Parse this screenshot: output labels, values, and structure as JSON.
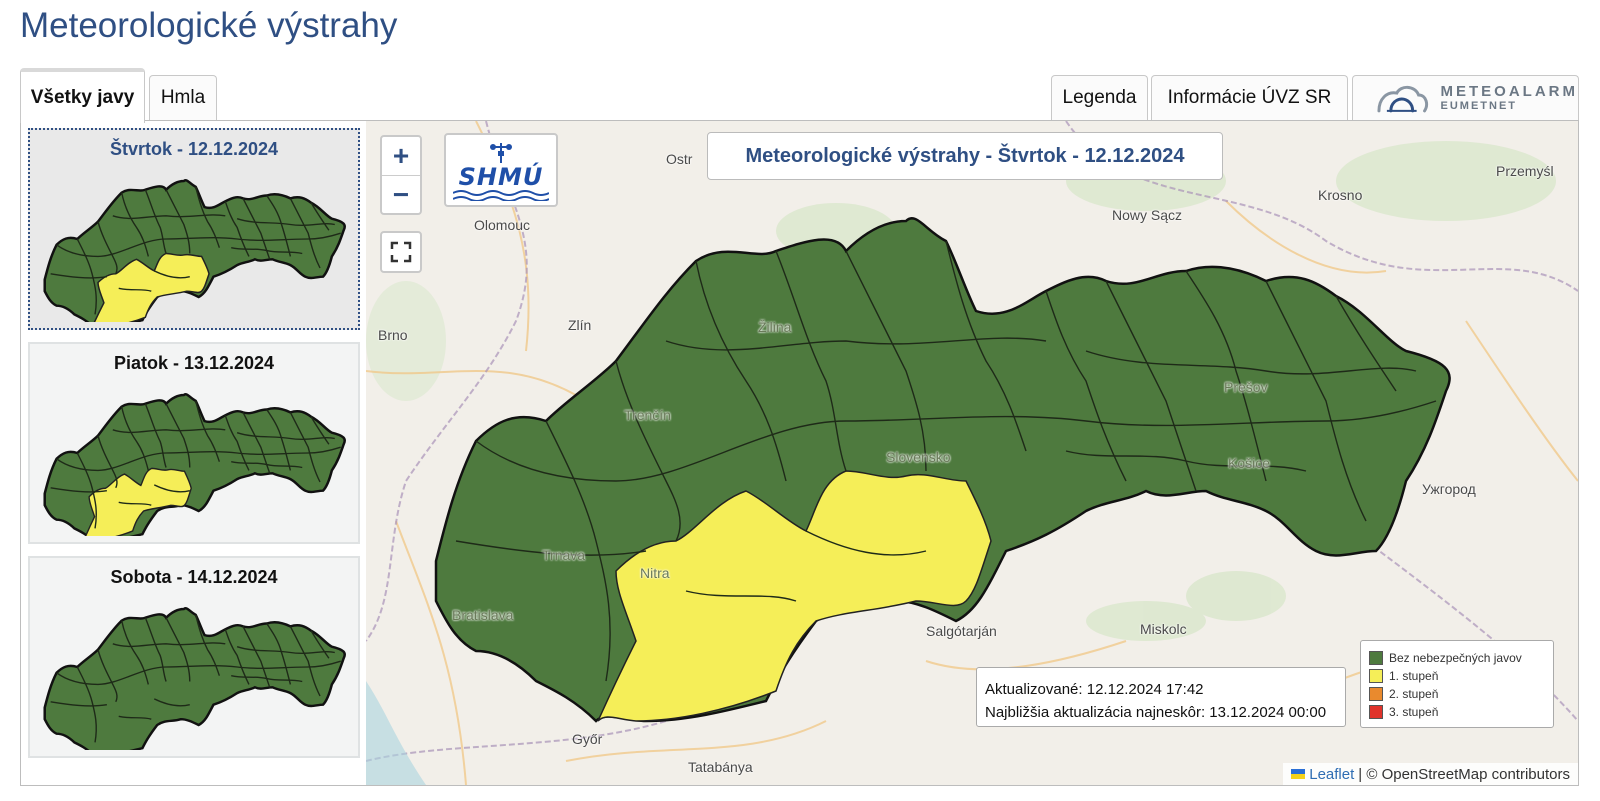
{
  "page_title": "Meteorologické výstrahy",
  "tabs": {
    "all": "Všetky javy",
    "fog": "Hmla",
    "legend": "Legenda",
    "info": "Informácie ÚVZ SR",
    "meteoalarm_main": "METEOALARM",
    "meteoalarm_sub": "EUMETNET"
  },
  "days": [
    {
      "label": "Štvrtok - 12.12.2024",
      "active": true,
      "warning_fraction": "high"
    },
    {
      "label": "Piatok - 13.12.2024",
      "active": false,
      "warning_fraction": "medium"
    },
    {
      "label": "Sobota - 14.12.2024",
      "active": false,
      "warning_fraction": "none"
    }
  ],
  "map": {
    "title": "Meteorologické výstrahy - Štvrtok - 12.12.2024",
    "logo_text": "SHMÚ",
    "zoom_in": "+",
    "zoom_out": "−",
    "places": {
      "olomouc": "Olomouc",
      "brno": "Brno",
      "zlin": "Zlín",
      "zilina": "Žilina",
      "trencin": "Trenčín",
      "trnava": "Trnava",
      "nitra": "Nitra",
      "bratislava": "Bratislava",
      "slovensko": "Slovensko",
      "presov": "Prešov",
      "kosice": "Košice",
      "uzhorod": "Ужгород",
      "nowy_sacz": "Nowy Sącz",
      "krosno": "Krosno",
      "przemysl": "Przemyśl",
      "salgotarjan": "Salgótarján",
      "miskolc": "Miskolc",
      "gyor": "Győr",
      "tatabanya": "Tatabánya",
      "ostrava": "Ostr"
    },
    "update": {
      "updated": "Aktualizované: 12.12.2024 17:42",
      "next": "Najbližšia aktualizácia najneskôr: 13.12.2024 00:00"
    },
    "legend": [
      {
        "label": "Bez nebezpečných javov",
        "color": "#4e7a3e"
      },
      {
        "label": "1. stupeň",
        "color": "#f5ee58"
      },
      {
        "label": "2. stupeň",
        "color": "#e98a2e"
      },
      {
        "label": "3. stupeň",
        "color": "#e0332b"
      }
    ],
    "attribution": {
      "leaflet": "Leaflet",
      "rest": "| © OpenStreetMap contributors"
    }
  },
  "colors": {
    "accent": "#2f4f83",
    "green": "#4e7a3e",
    "yellow": "#f5ee58"
  }
}
